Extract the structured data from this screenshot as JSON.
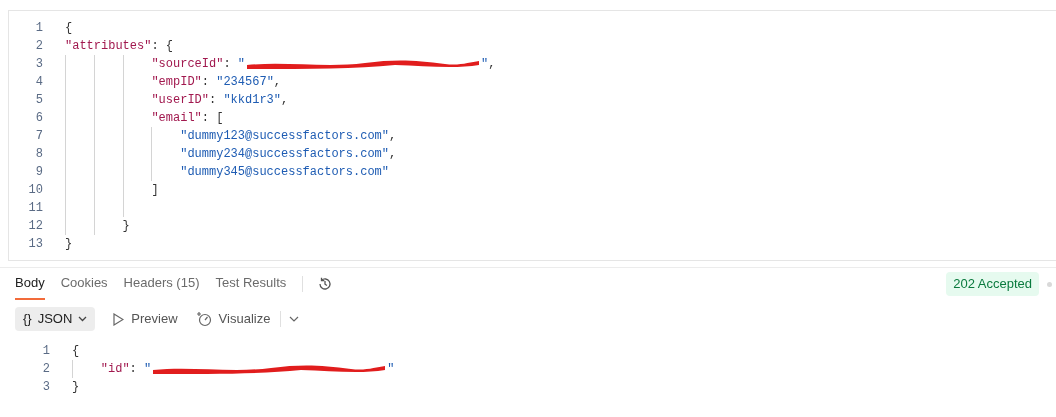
{
  "request_body": {
    "lines": [
      {
        "kind": "line",
        "number": "1",
        "tokens": [
          {
            "kind": "punct",
            "text": "{"
          }
        ]
      },
      {
        "kind": "line",
        "number": "2",
        "tokens": [
          {
            "kind": "key",
            "text": "\"attributes\""
          },
          {
            "kind": "punct",
            "text": ": {"
          }
        ]
      },
      {
        "kind": "block",
        "children": [
          {
            "kind": "block",
            "children": [
              {
                "kind": "block",
                "children": [
                  {
                    "kind": "line",
                    "number": "3",
                    "tokens": [
                      {
                        "kind": "key",
                        "text": "\"sourceId\""
                      },
                      {
                        "kind": "punct",
                        "text": ": "
                      },
                      {
                        "kind": "string",
                        "text": "\""
                      },
                      {
                        "kind": "redaction"
                      },
                      {
                        "kind": "string",
                        "text": "\""
                      },
                      {
                        "kind": "punct",
                        "text": ","
                      }
                    ]
                  },
                  {
                    "kind": "line",
                    "number": "4",
                    "tokens": [
                      {
                        "kind": "key",
                        "text": "\"empID\""
                      },
                      {
                        "kind": "punct",
                        "text": ": "
                      },
                      {
                        "kind": "string",
                        "text": "\"234567\""
                      },
                      {
                        "kind": "punct",
                        "text": ","
                      }
                    ]
                  },
                  {
                    "kind": "line",
                    "number": "5",
                    "tokens": [
                      {
                        "kind": "key",
                        "text": "\"userID\""
                      },
                      {
                        "kind": "punct",
                        "text": ": "
                      },
                      {
                        "kind": "string",
                        "text": "\"kkd1r3\""
                      },
                      {
                        "kind": "punct",
                        "text": ","
                      }
                    ]
                  },
                  {
                    "kind": "line",
                    "number": "6",
                    "tokens": [
                      {
                        "kind": "key",
                        "text": "\"email\""
                      },
                      {
                        "kind": "punct",
                        "text": ": ["
                      }
                    ]
                  },
                  {
                    "kind": "block",
                    "children": [
                      {
                        "kind": "line",
                        "number": "7",
                        "tokens": [
                          {
                            "kind": "string",
                            "text": "\"dummy123@successfactors.com\""
                          },
                          {
                            "kind": "punct",
                            "text": ","
                          }
                        ]
                      },
                      {
                        "kind": "line",
                        "number": "8",
                        "tokens": [
                          {
                            "kind": "string",
                            "text": "\"dummy234@successfactors.com\""
                          },
                          {
                            "kind": "punct",
                            "text": ","
                          }
                        ]
                      },
                      {
                        "kind": "line",
                        "number": "9",
                        "tokens": [
                          {
                            "kind": "string",
                            "text": "\"dummy345@successfactors.com\""
                          }
                        ]
                      }
                    ]
                  },
                  {
                    "kind": "line",
                    "number": "10",
                    "tokens": [
                      {
                        "kind": "punct",
                        "text": "]"
                      }
                    ]
                  },
                  {
                    "kind": "line",
                    "number": "11"
                  }
                ]
              },
              {
                "kind": "line",
                "number": "12",
                "tokens": [
                  {
                    "kind": "punct",
                    "text": "}"
                  }
                ]
              }
            ]
          }
        ]
      },
      {
        "kind": "line",
        "number": "13",
        "tokens": [
          {
            "kind": "punct",
            "text": "}"
          }
        ]
      }
    ]
  },
  "response": {
    "tabs": [
      {
        "label": "Body",
        "selected": true
      },
      {
        "label": "Cookies",
        "selected": false
      },
      {
        "label": "Headers (15)",
        "selected": false
      },
      {
        "label": "Test Results",
        "selected": false
      }
    ],
    "status": "202 Accepted",
    "format": {
      "icon": "{}",
      "label": "JSON"
    },
    "view_buttons": [
      "Preview",
      "Visualize"
    ],
    "lines": [
      {
        "kind": "line",
        "number": "1",
        "tokens": [
          {
            "kind": "punct",
            "text": "{"
          }
        ]
      },
      {
        "kind": "block",
        "children": [
          {
            "kind": "line",
            "number": "2",
            "tokens": [
              {
                "kind": "key",
                "text": "\"id\""
              },
              {
                "kind": "punct",
                "text": ": "
              },
              {
                "kind": "string",
                "text": "\""
              },
              {
                "kind": "redaction"
              },
              {
                "kind": "string",
                "text": "\""
              }
            ]
          }
        ]
      },
      {
        "kind": "line",
        "number": "3",
        "tokens": [
          {
            "kind": "punct",
            "text": "}"
          }
        ]
      }
    ]
  }
}
